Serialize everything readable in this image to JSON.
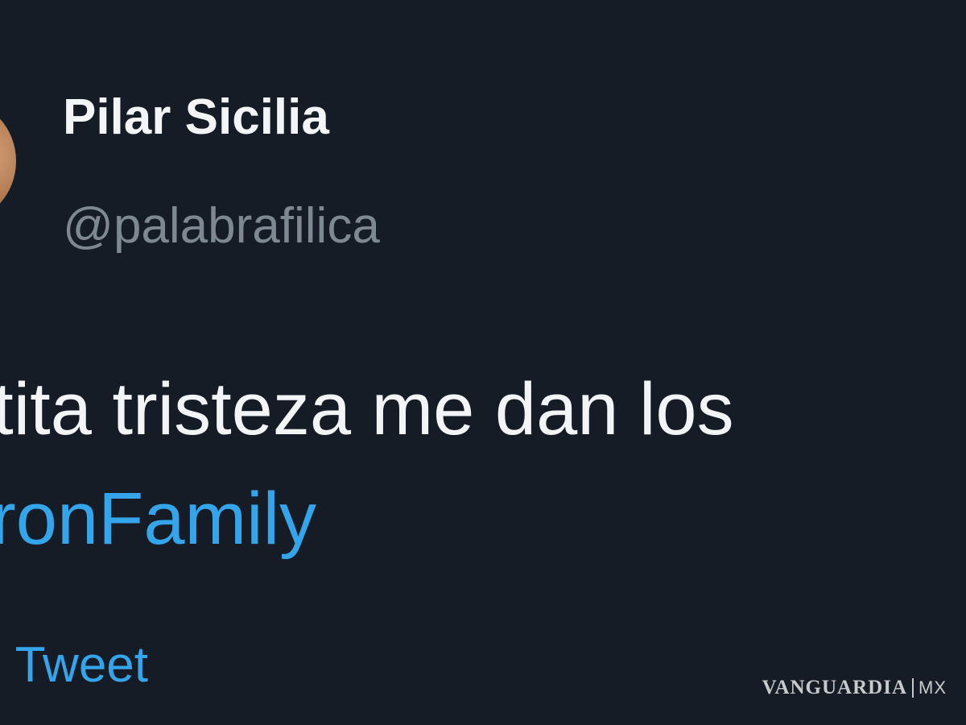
{
  "tweet": {
    "author_name": "Pilar Sicilia",
    "author_handle": "@palabrafilica",
    "text_visible": "ntita tristeza me dan los",
    "hashtag_visible": "aronFamily",
    "translate_visible": "e Tweet"
  },
  "watermark": {
    "brand": "VANGUARDIA",
    "country": "MX"
  },
  "colors": {
    "background": "#151c26",
    "text_primary": "#f2f4f6",
    "text_secondary": "#7e8893",
    "link": "#34a5ea"
  }
}
